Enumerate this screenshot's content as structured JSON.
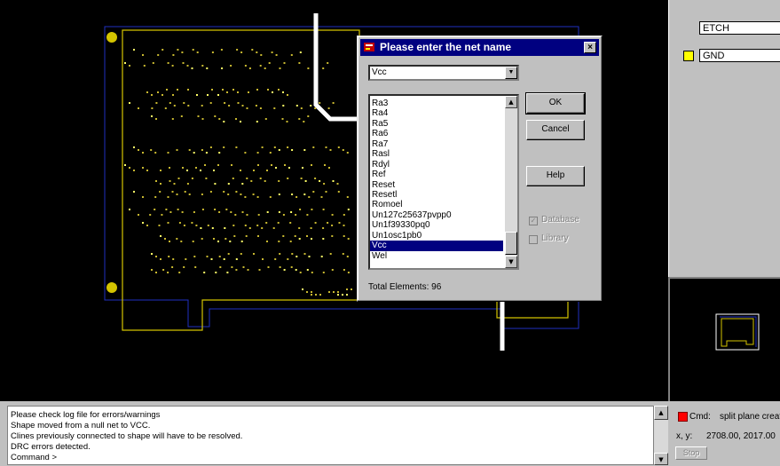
{
  "dialog": {
    "title": "Please enter the net name",
    "selected_value": "Vcc",
    "list_items": [
      "Ra3",
      "Ra4",
      "Ra5",
      "Ra6",
      "Ra7",
      "Rasl",
      "Rdyl",
      "Ref",
      "Reset",
      "Resetl",
      "Romoel",
      "Un127c25637pvpp0",
      "Un1f39330pq0",
      "Un1osc1pb0",
      "Vcc",
      "Wel"
    ],
    "selected_item": "Vcc",
    "buttons": {
      "ok": "OK",
      "cancel": "Cancel",
      "help": "Help"
    },
    "checkboxes": [
      {
        "label": "Database",
        "checked": true,
        "enabled": false
      },
      {
        "label": "Library",
        "checked": false,
        "enabled": false
      }
    ],
    "total_elements": "Total Elements: 96",
    "close_label": "×"
  },
  "right_panel": {
    "class_field": "ETCH",
    "subclass_field": "GND",
    "subclass_color": "#ffff00"
  },
  "console": {
    "lines": [
      "Please check log file for errors/warnings",
      "Shape moved from a null net to VCC.",
      "Clines previously connected to shape will have to be resolved.",
      "DRC errors detected.",
      "Command >"
    ]
  },
  "status": {
    "cmd_label": "Cmd:",
    "cmd_value": "split plane creat",
    "cmd_indicator_color": "#ff0000",
    "coord_label": "x, y:",
    "coord_value": "2708.00, 2017.00",
    "stop_label": "Stop"
  },
  "colors": {
    "canvas_bg": "#000000",
    "board_outline": "#d4c400",
    "plane_outline": "#2030c0",
    "trace": "#ffffff",
    "via": "#ffff66",
    "selection": "#000080"
  }
}
